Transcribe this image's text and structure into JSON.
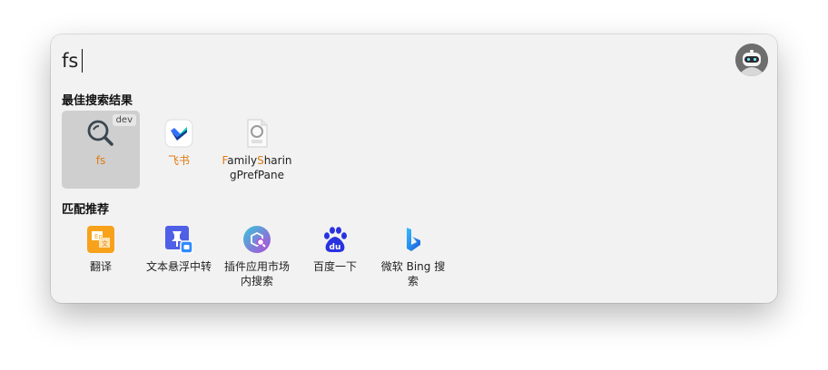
{
  "search": {
    "query": "fs"
  },
  "sections": {
    "best": "最佳搜索结果",
    "recommend": "匹配推荐"
  },
  "best_results": [
    {
      "label": "fs",
      "badge": "dev",
      "icon": "magnifier-icon"
    },
    {
      "label": "飞书",
      "icon": "feishu-icon"
    },
    {
      "label_parts": [
        "F",
        "amily",
        "S",
        "haringPrefPane"
      ],
      "icon": "pref-pane-file-icon"
    }
  ],
  "recommendations": [
    {
      "label": "翻译",
      "icon": "translate-icon"
    },
    {
      "label": "文本悬浮中转",
      "icon": "pin-float-icon"
    },
    {
      "label": "插件应用市场内搜索",
      "icon": "plugin-market-search-icon"
    },
    {
      "label": "百度一下",
      "icon": "baidu-icon"
    },
    {
      "label": "微软 Bing 搜索",
      "icon": "bing-icon"
    }
  ],
  "colors": {
    "accent": "#e07a12",
    "window_bg": "#f2f2f2",
    "selected_bg": "#cfcfcf"
  }
}
